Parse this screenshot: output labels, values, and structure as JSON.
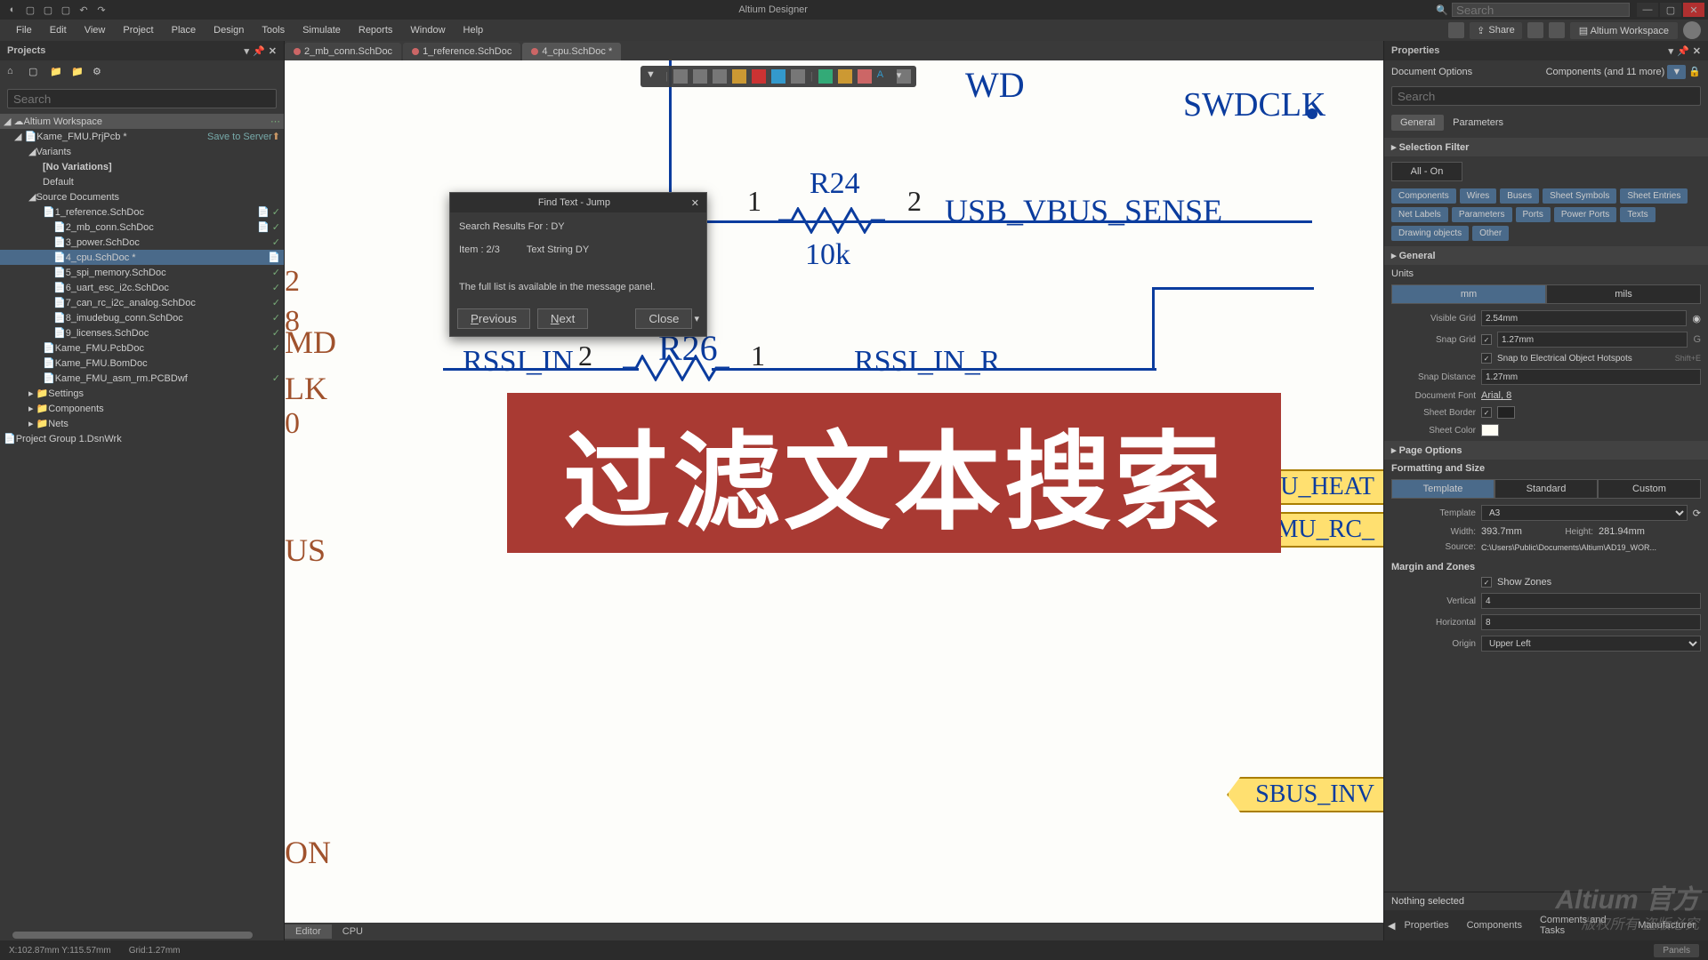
{
  "app": {
    "title": "Altium Designer",
    "search_placeholder": "Search"
  },
  "workspace_btn": "Altium Workspace",
  "share_btn": "Share",
  "menu": [
    "File",
    "Edit",
    "View",
    "Project",
    "Place",
    "Design",
    "Tools",
    "Simulate",
    "Reports",
    "Window",
    "Help"
  ],
  "projects": {
    "panel_title": "Projects",
    "search_placeholder": "Search",
    "workspace": "Altium Workspace",
    "project": "Kame_FMU.PrjPcb *",
    "save_link": "Save to Server",
    "variants_label": "Variants",
    "no_variations": "[No Variations]",
    "default_variant": "Default",
    "source_docs": "Source Documents",
    "docs": [
      "1_reference.SchDoc",
      "2_mb_conn.SchDoc",
      "3_power.SchDoc",
      "4_cpu.SchDoc *",
      "5_spi_memory.SchDoc",
      "6_uart_esc_i2c.SchDoc",
      "7_can_rc_i2c_analog.SchDoc",
      "8_imudebug_conn.SchDoc",
      "9_licenses.SchDoc"
    ],
    "pcb_doc": "Kame_FMU.PcbDoc",
    "bom_doc": "Kame_FMU.BomDoc",
    "asm_doc": "Kame_FMU_asm_rm.PCBDwf",
    "settings": "Settings",
    "components": "Components",
    "nets": "Nets",
    "group": "Project Group 1.DsnWrk"
  },
  "tabs": [
    {
      "label": "2_mb_conn.SchDoc",
      "active": false
    },
    {
      "label": "1_reference.SchDoc",
      "active": false
    },
    {
      "label": "4_cpu.SchDoc *",
      "active": true
    }
  ],
  "find_dialog": {
    "title": "Find Text - Jump",
    "results_for": "Search Results For : DY",
    "item": "Item : 2/3",
    "text_string": "Text String DY",
    "full_list": "The full list is available in the message panel.",
    "prev": "Previous",
    "next": "Next",
    "close": "Close"
  },
  "schematic": {
    "swd_label": "WD",
    "swdclk": "SWDCLK",
    "r24": "R24",
    "r24_val": "10k",
    "usb_vbus": "USB_VBUS_SENSE",
    "r26": "R26",
    "rssi_in": "RSSI_IN",
    "rssi_in_r": "RSSI_IN_R",
    "md": "MD",
    "lk": "LK",
    "us": "US",
    "on": "ON",
    "heat": "U_HEAT",
    "rc": "MU_RC_",
    "sbus_inv": "SBUS_INV",
    "pin1": "1",
    "pin2": "2",
    "eight": "8",
    "two": "2",
    "zero": "0"
  },
  "banner_text": "过滤文本搜索",
  "center_tabs": [
    "Editor",
    "CPU"
  ],
  "properties": {
    "panel_title": "Properties",
    "doc_options": "Document Options",
    "components_more": "Components (and 11 more)",
    "search_placeholder": "Search",
    "tab_general": "General",
    "tab_parameters": "Parameters",
    "sel_filter": "Selection Filter",
    "all_on": "All - On",
    "filter_tags": [
      "Components",
      "Wires",
      "Buses",
      "Sheet Symbols",
      "Sheet Entries",
      "Net Labels",
      "Parameters",
      "Ports",
      "Power Ports",
      "Texts",
      "Drawing objects",
      "Other"
    ],
    "general": "General",
    "units": "Units",
    "mm": "mm",
    "mils": "mils",
    "visible_grid": "Visible Grid",
    "visible_grid_val": "2.54mm",
    "snap_grid": "Snap Grid",
    "snap_grid_val": "1.27mm",
    "snap_electrical": "Snap to Electrical Object Hotspots",
    "snap_electrical_hint": "Shift+E",
    "snap_distance": "Snap Distance",
    "snap_distance_val": "1.27mm",
    "doc_font": "Document Font",
    "doc_font_val": "Arial, 8",
    "sheet_border": "Sheet Border",
    "sheet_color": "Sheet Color",
    "page_options": "Page Options",
    "formatting": "Formatting and Size",
    "template": "Template",
    "standard": "Standard",
    "custom": "Custom",
    "template_label": "Template",
    "template_val": "A3",
    "width_label": "Width:",
    "width_val": "393.7mm",
    "height_label": "Height:",
    "height_val": "281.94mm",
    "source_label": "Source:",
    "source_val": "C:\\Users\\Public\\Documents\\Altium\\AD19_WOR...",
    "margin_zones": "Margin and Zones",
    "show_zones": "Show Zones",
    "vertical": "Vertical",
    "vertical_val": "4",
    "horizontal": "Horizontal",
    "horizontal_val": "8",
    "origin": "Origin",
    "origin_val": "Upper Left",
    "nothing_selected": "Nothing selected"
  },
  "bottom_tabs": [
    "Properties",
    "Components",
    "Comments and Tasks",
    "Manufacturer"
  ],
  "panels_btn": "Panels",
  "status": {
    "coords": "X:102.87mm Y:115.57mm",
    "grid": "Grid:1.27mm"
  },
  "watermark": {
    "brand": "Altium 官方",
    "rights": "版权所有 盗版必究"
  }
}
